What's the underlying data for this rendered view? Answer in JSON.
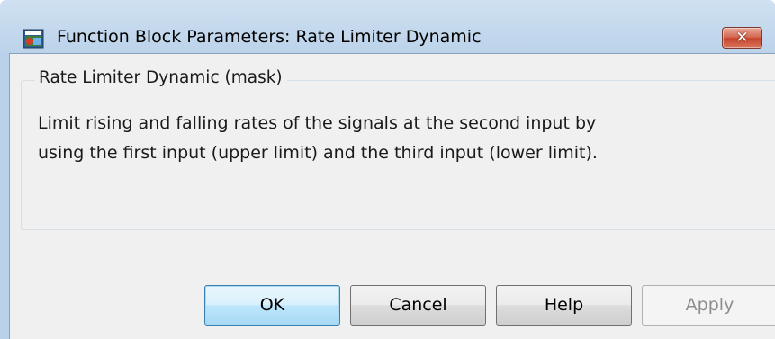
{
  "window": {
    "title": "Function Block Parameters: Rate Limiter Dynamic",
    "app_icon": "simulink-block-icon",
    "close_glyph": "✕"
  },
  "group": {
    "legend": "Rate Limiter Dynamic (mask)",
    "description_lines": [
      "Limit rising and falling rates of the signals at the second input by",
      "using the first input (upper limit) and the third input (lower limit)."
    ]
  },
  "buttons": {
    "ok": "OK",
    "cancel": "Cancel",
    "help": "Help",
    "apply": "Apply",
    "apply_enabled": false
  },
  "colors": {
    "titlebar": "#bcd3ea",
    "client": "#f0f0f0",
    "close_button": "#c7442c",
    "ok_focus": "#3c7fb1"
  }
}
